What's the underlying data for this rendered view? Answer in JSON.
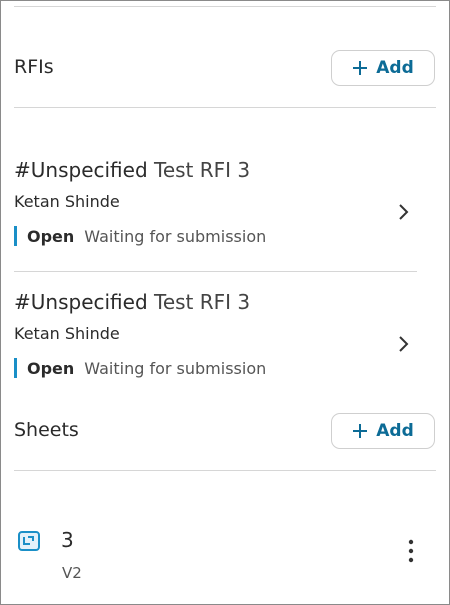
{
  "rfis": {
    "title": "RFIs",
    "add_label": "Add",
    "items": [
      {
        "number": "#Unspecified",
        "name": "Test RFI 3",
        "assignee": "Ketan Shinde",
        "status": "Open",
        "status_detail": "Waiting for submission"
      },
      {
        "number": "#Unspecified",
        "name": "Test RFI 3",
        "assignee": "Ketan Shinde",
        "status": "Open",
        "status_detail": "Waiting for submission"
      }
    ]
  },
  "sheets": {
    "title": "Sheets",
    "add_label": "Add",
    "items": [
      {
        "name": "3",
        "version": "V2"
      }
    ]
  },
  "colors": {
    "accent": "#0c6b96",
    "status_open": "#1a8fc7",
    "divider": "#d6d6d6"
  },
  "icons": {
    "add": "plus-icon",
    "chevron": "chevron-right-icon",
    "sheet": "sheet-icon",
    "more": "more-vertical-icon"
  }
}
